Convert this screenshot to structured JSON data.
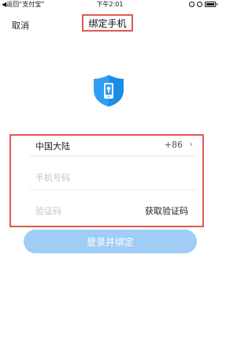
{
  "status_bar": {
    "back_label": "◀返回“支付宝”",
    "time": "下午2:01"
  },
  "nav": {
    "cancel_label": "取消",
    "title": "绑定手机"
  },
  "country": {
    "name": "中国大陆",
    "code": "+86"
  },
  "form": {
    "phone_placeholder": "手机号码",
    "code_placeholder": "验证码",
    "get_code_label": "获取验证码"
  },
  "submit_label": "登录并绑定",
  "colors": {
    "accent": "#2e9ff2",
    "button_disabled": "#9fcdf6",
    "highlight": "#e05a4e"
  },
  "icons": [
    "shield-phone-icon",
    "chevron-right-icon",
    "alarm-icon",
    "lock-rotation-icon",
    "battery-icon"
  ]
}
